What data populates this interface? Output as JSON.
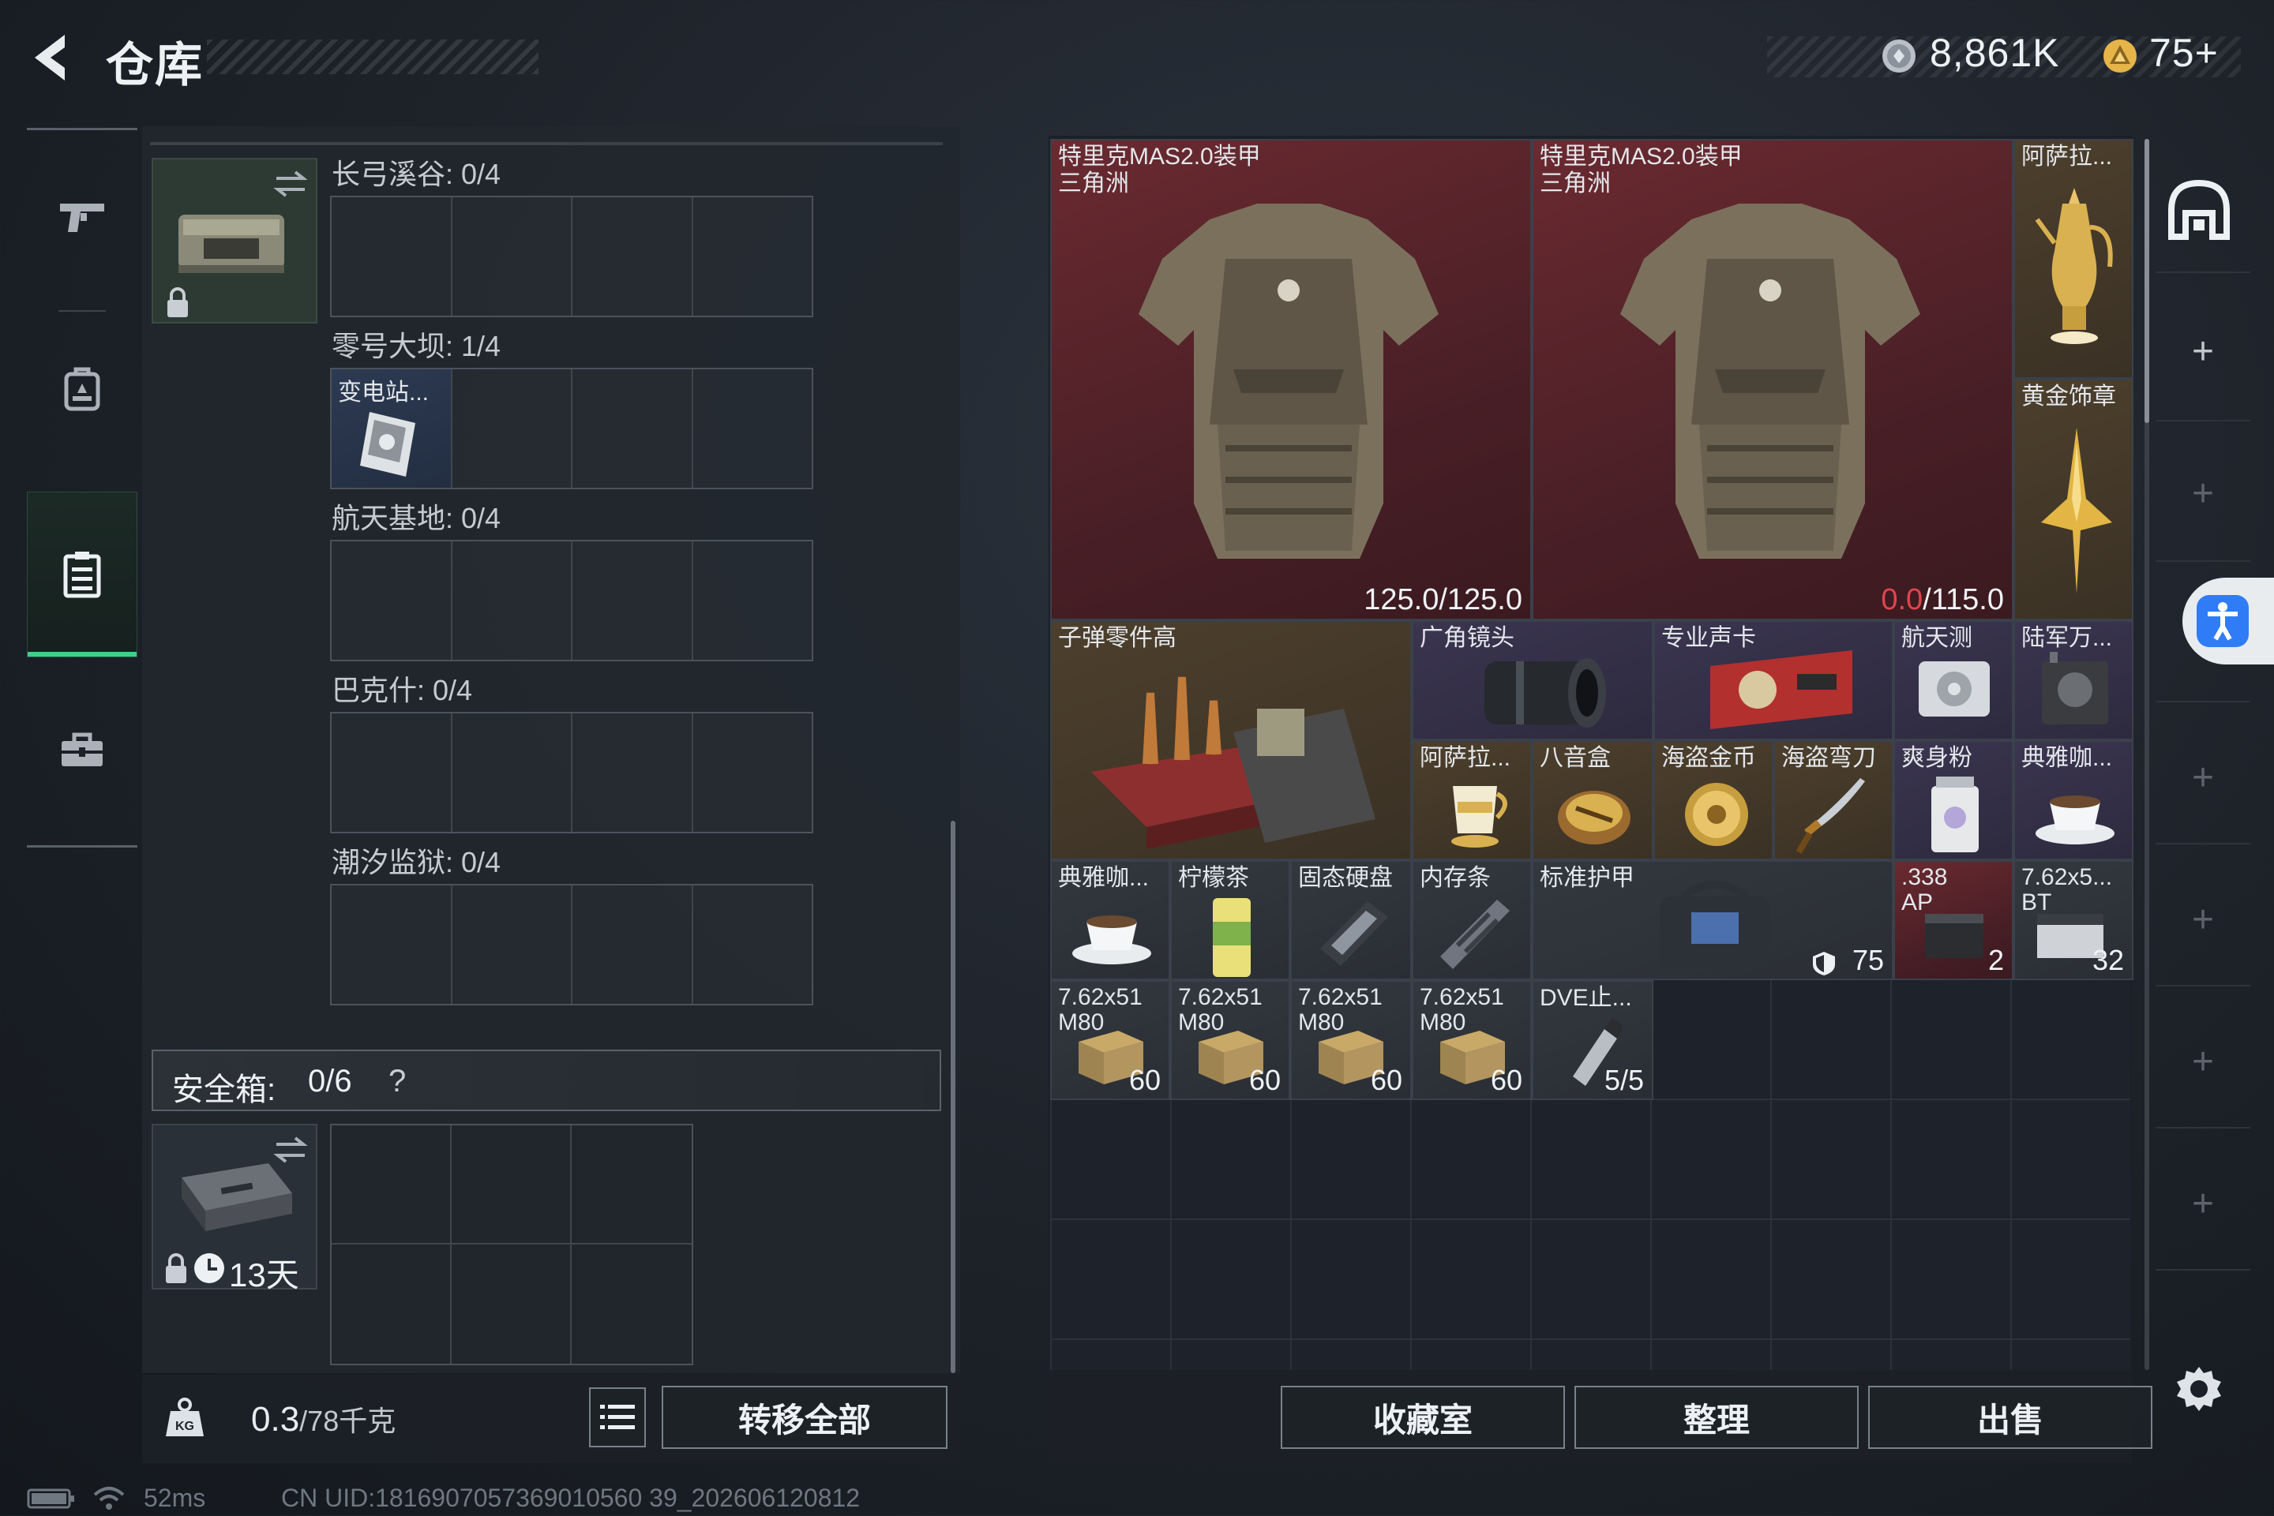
{
  "header": {
    "title": "仓库",
    "currency1": "8,861K",
    "currency2": "75+"
  },
  "nav": {
    "items": [
      "weapon",
      "backpack",
      "storage",
      "toolbox"
    ],
    "active": "storage"
  },
  "left": {
    "maps": [
      {
        "label": "长弓溪谷: 0/4"
      },
      {
        "label": "零号大坝: 1/4",
        "item": "变电站..."
      },
      {
        "label": "航天基地: 0/4"
      },
      {
        "label": "巴克什: 0/4"
      },
      {
        "label": "潮汐监狱: 0/4"
      }
    ],
    "safe_label": "安全箱:",
    "safe_count": "0/6",
    "safe_help": "?",
    "safe_days": "13天",
    "weight_value": "0.3",
    "weight_unit": "/78千克",
    "transfer_all": "转移全部"
  },
  "inventory": {
    "armor1_name": "特里克MAS2.0装甲",
    "armor1_sub": "三角洲",
    "armor1_dur": "125.0/125.0",
    "armor2_name": "特里克MAS2.0装甲",
    "armor2_sub": "三角洲",
    "armor2_dur_cur": "0.0",
    "armor2_dur_max": "/115.0",
    "items": [
      {
        "name": "阿萨拉...",
        "count": ""
      },
      {
        "name": "黄金饰章",
        "count": ""
      },
      {
        "name": "子弹零件高",
        "count": ""
      },
      {
        "name": "广角镜头",
        "count": ""
      },
      {
        "name": "专业声卡",
        "count": ""
      },
      {
        "name": "航天测",
        "count": ""
      },
      {
        "name": "陆军万...",
        "count": ""
      },
      {
        "name": "阿萨拉...",
        "count": ""
      },
      {
        "name": "八音盒",
        "count": ""
      },
      {
        "name": "海盗金币",
        "count": ""
      },
      {
        "name": "海盗弯刀",
        "count": ""
      },
      {
        "name": "爽身粉",
        "count": ""
      },
      {
        "name": "典雅咖...",
        "count": ""
      },
      {
        "name": "典雅咖...",
        "count": ""
      },
      {
        "name": "柠檬茶",
        "count": ""
      },
      {
        "name": "固态硬盘",
        "count": ""
      },
      {
        "name": "内存条",
        "count": ""
      },
      {
        "name": "标准护甲",
        "count": "75"
      },
      {
        "name": ".338 AP",
        "count": "2"
      },
      {
        "name": "7.62x5... BT",
        "count": "32"
      },
      {
        "name": "7.62x51 M80",
        "count": "60"
      },
      {
        "name": "7.62x51 M80",
        "count": "60"
      },
      {
        "name": "7.62x51 M80",
        "count": "60"
      },
      {
        "name": "7.62x51 M80",
        "count": "60"
      },
      {
        "name": "DVE止...",
        "count": "5/5"
      }
    ]
  },
  "bottom_buttons": {
    "collection": "收藏室",
    "sort": "整理",
    "sell": "出售"
  },
  "status": {
    "ping": "52ms",
    "uid": "CN UID:1816907057369010560 39_202606120812"
  },
  "colors": {
    "active_green": "#3fd08a",
    "armor_red": "#4a1f26",
    "durability_red": "#e0454d",
    "accessibility_blue": "#2f7cf6"
  }
}
